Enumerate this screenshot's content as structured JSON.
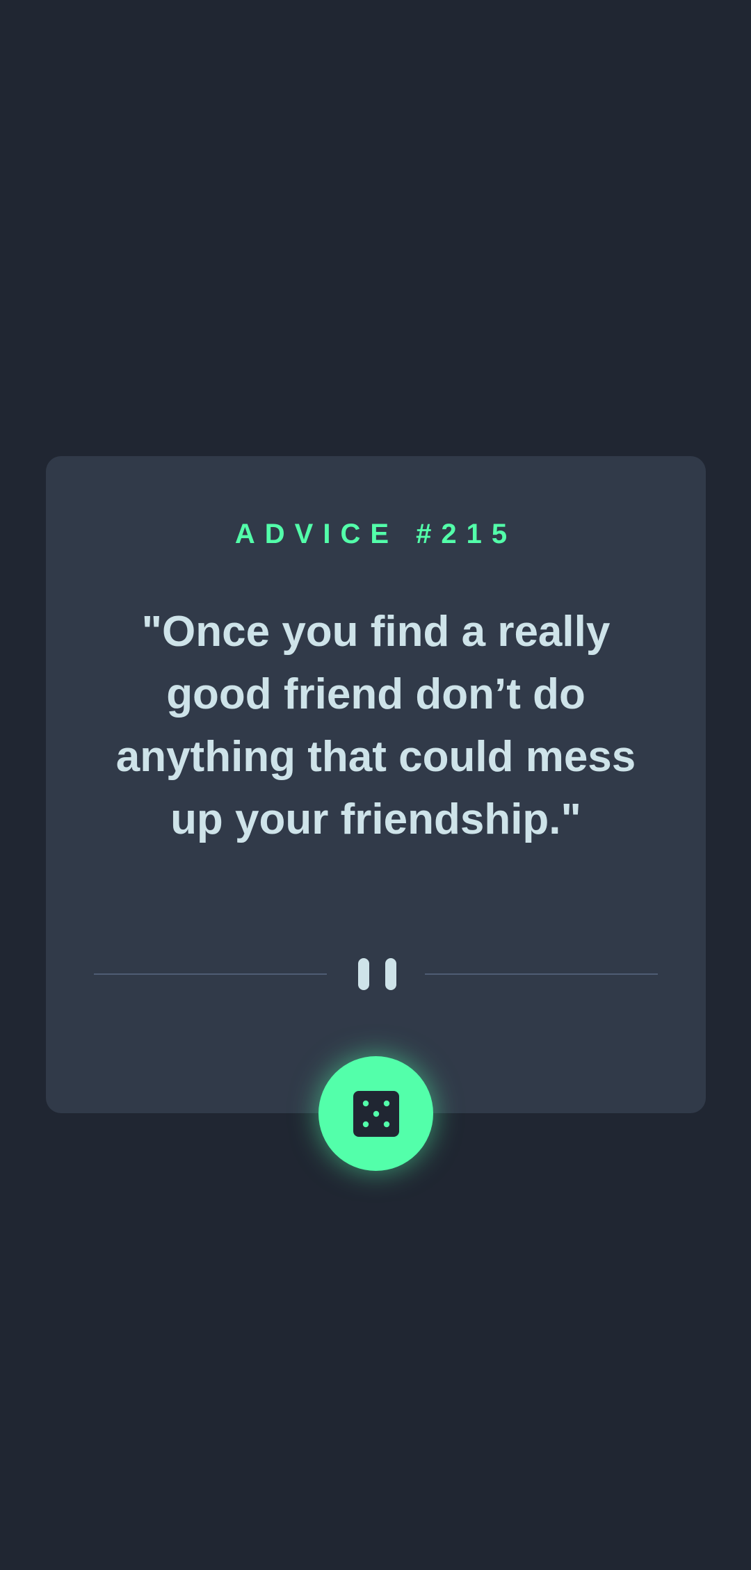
{
  "card": {
    "label_prefix": "ADVICE #",
    "advice_id": "215",
    "quote": "\"Once you find a really good friend don’t do anything that could mess up your friendship.\""
  },
  "divider": {
    "icon": "pause-icon"
  },
  "action": {
    "icon": "dice-icon"
  },
  "colors": {
    "background": "#202632",
    "card": "#313a49",
    "accent": "#53ffaa",
    "text": "#cee3e9",
    "divider": "#4f5d74"
  }
}
